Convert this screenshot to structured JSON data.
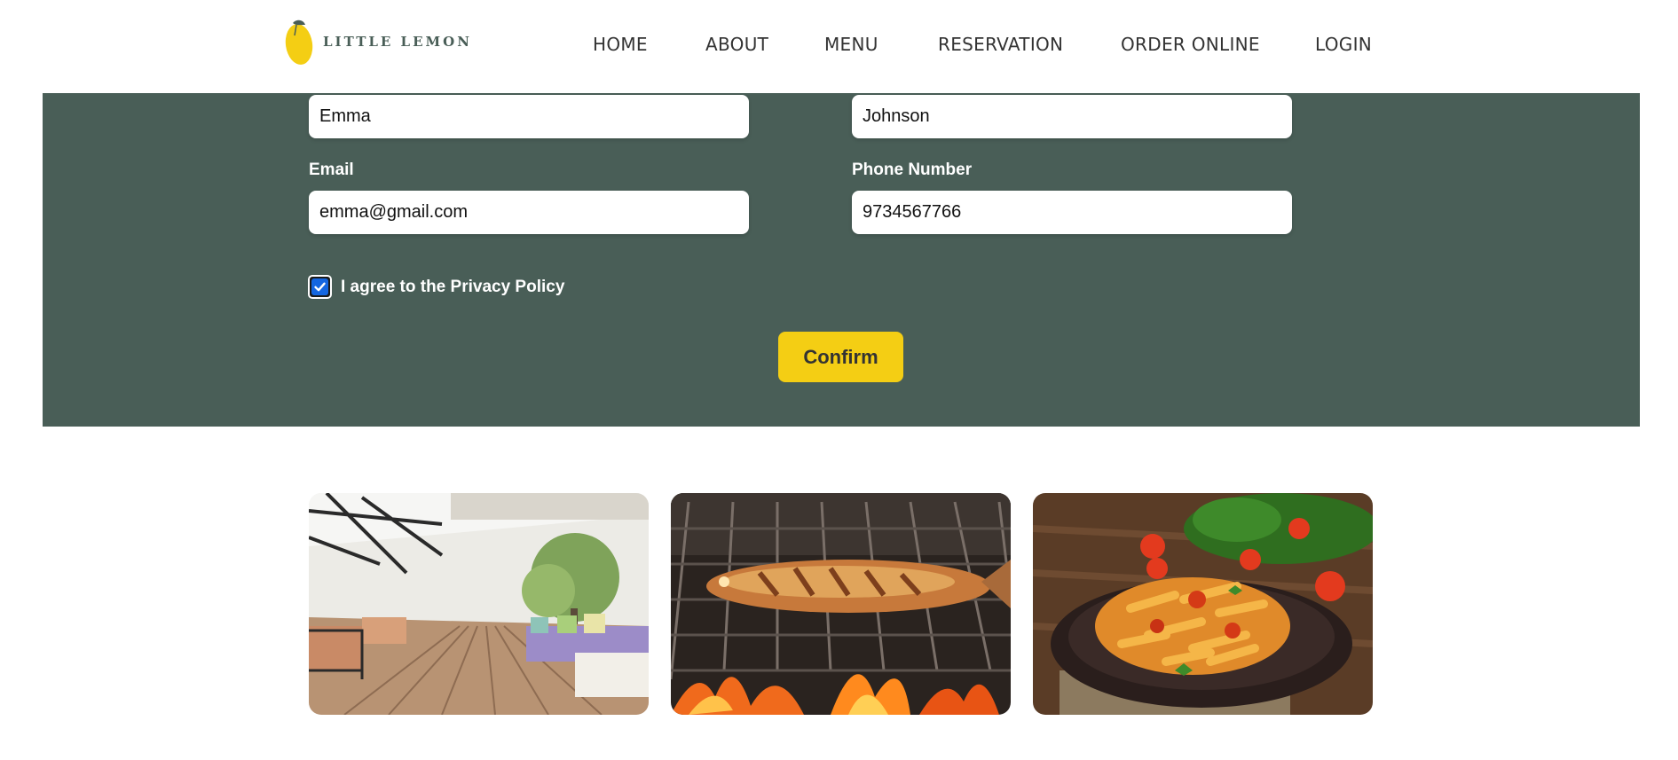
{
  "header": {
    "logo_text": "LITTLE LEMON",
    "nav": [
      {
        "label": "HOME"
      },
      {
        "label": "ABOUT"
      },
      {
        "label": "MENU"
      },
      {
        "label": "RESERVATION"
      },
      {
        "label": "ORDER ONLINE"
      },
      {
        "label": "LOGIN"
      }
    ]
  },
  "form": {
    "first_name_value": "Emma",
    "last_name_value": "Johnson",
    "email_label": "Email",
    "email_value": "emma@gmail.com",
    "phone_label": "Phone Number",
    "phone_value": "9734567766",
    "privacy_label": "I agree to the Privacy Policy",
    "privacy_checked": true,
    "confirm_label": "Confirm"
  },
  "colors": {
    "brand_green": "#495e57",
    "brand_yellow": "#f4ce14",
    "checkbox_blue": "#1466e0"
  },
  "photos": [
    {
      "subject": "restaurant-terrace"
    },
    {
      "subject": "grilled-fish"
    },
    {
      "subject": "penne-pasta"
    }
  ]
}
